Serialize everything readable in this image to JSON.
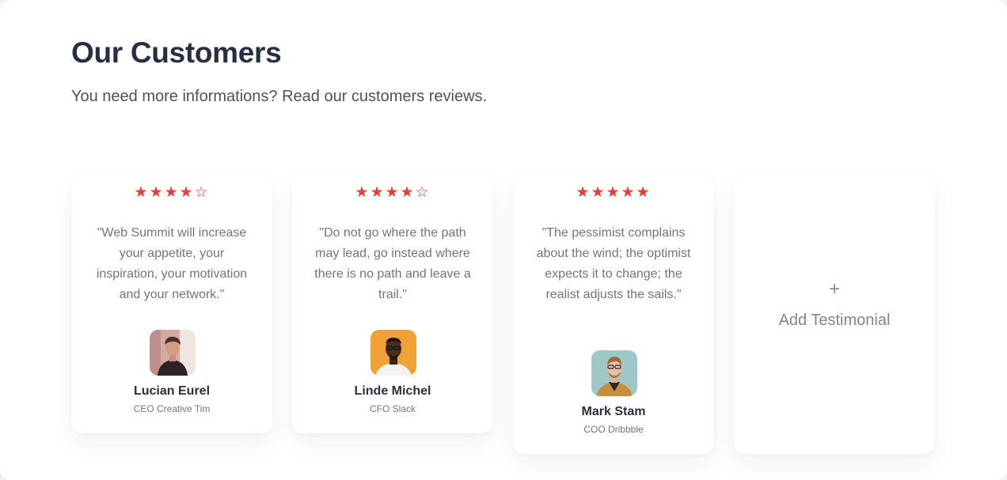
{
  "header": {
    "title": "Our Customers",
    "subtitle": "You need more informations? Read our customers reviews."
  },
  "colors": {
    "star": "#ea3c3c",
    "title": "#263042",
    "text": "#6f7583"
  },
  "testimonials": [
    {
      "rating": 4,
      "max_rating": 5,
      "stars": "★★★★☆",
      "quote": "\"Web Summit will increase your appetite, your inspiration, your motivation and your network.\"",
      "name": "Lucian Eurel",
      "role": "CEO Creative Tim",
      "avatar_icon": "person-avatar"
    },
    {
      "rating": 4,
      "max_rating": 5,
      "stars": "★★★★☆",
      "quote": "\"Do not go where the path may lead, go instead where there is no path and leave a trail.\"",
      "name": "Linde Michel",
      "role": "CFO Slack",
      "avatar_icon": "person-avatar"
    },
    {
      "rating": 5,
      "max_rating": 5,
      "stars": "★★★★★",
      "quote": "\"The pessimist complains about the wind; the optimist expects it to change; the realist adjusts the sails.\"",
      "name": "Mark Stam",
      "role": "COO Dribbble",
      "avatar_icon": "person-avatar"
    }
  ],
  "add_card": {
    "icon": "plus-icon",
    "plus": "+",
    "label": "Add Testimonial"
  }
}
